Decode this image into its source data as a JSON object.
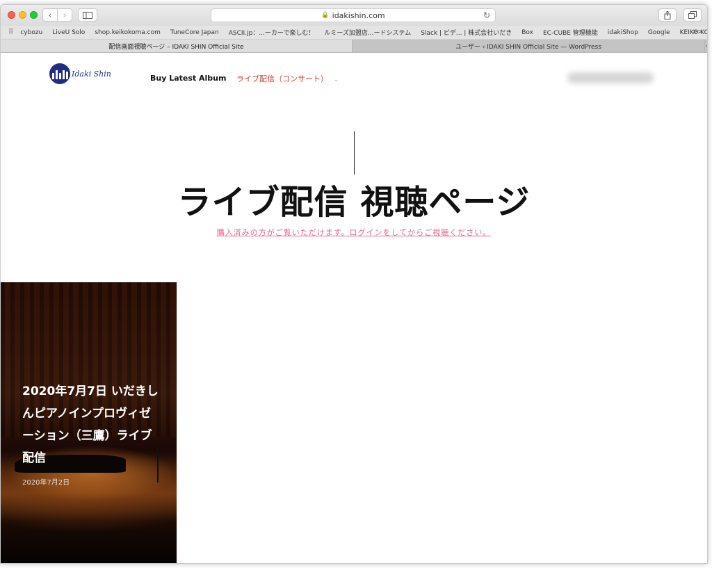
{
  "browser": {
    "url": "idakishin.com",
    "bookmarks": [
      "cybozu",
      "LiveU Solo",
      "shop.keikokoma.com",
      "TuneCore Japan",
      "ASCII.jp：...ーカーで楽しむ！",
      "ルミーズ加盟店...ードシステム",
      "Slack | ビデ... | 株式会社いだき",
      "Box",
      "EC-CUBE 管理機能",
      "idakiShop",
      "Google",
      "KEIKO KOMA"
    ],
    "more": ">>",
    "tabs": [
      {
        "title": "配信画面視聴ページ – IDAKI SHIN Official Site"
      },
      {
        "title": "ユーザー ‹ IDAKI SHIN Official Site — WordPress"
      }
    ],
    "new_tab": "+"
  },
  "site": {
    "logo_text": "Idaki Shin",
    "nav": {
      "album": "Buy Latest Album",
      "live": "ライブ配信（コンサート）",
      "caret": "⌄"
    },
    "page_title": "ライブ配信 視聴ページ",
    "subtitle": "購入済みの方がご覧いただけます。ログインをしてからご視聴ください。",
    "card": {
      "title": "2020年7月7日 いだきしんピアノインプロヴィゼーション（三鷹）ライブ配信",
      "date": "2020年7月2日"
    }
  },
  "colors": {
    "accent_red": "#d03b2b",
    "subtitle_pink": "#e0698e",
    "logo_blue": "#1f2d84"
  }
}
